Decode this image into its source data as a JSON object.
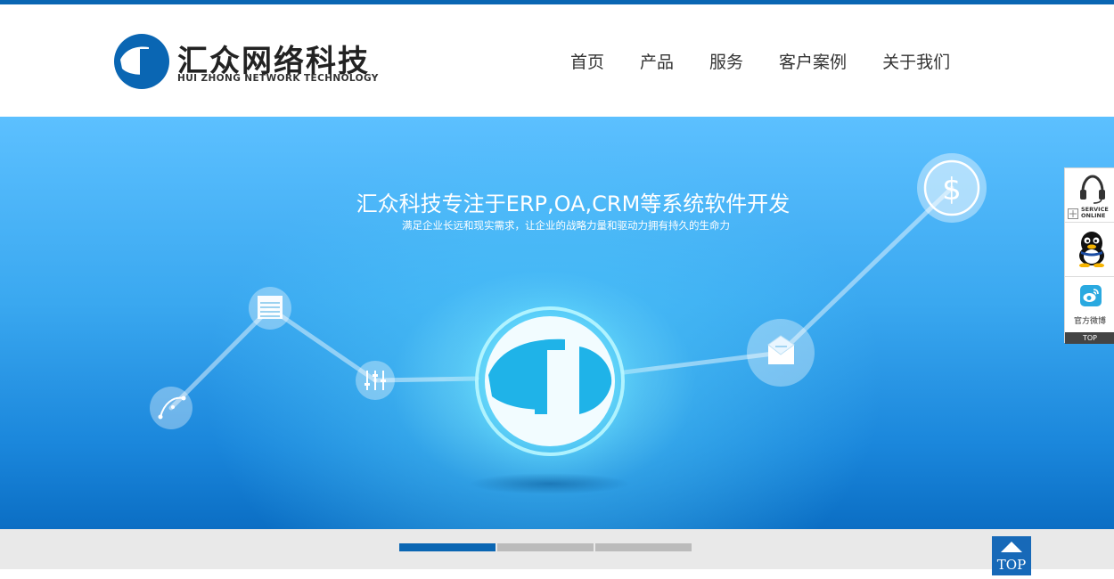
{
  "brand": {
    "name_cn": "汇众网络科技",
    "name_en": "HUI ZHONG NETWORK TECHNOLOGY",
    "color": "#0a66b3"
  },
  "nav": {
    "items": [
      {
        "label": "首页"
      },
      {
        "label": "产品"
      },
      {
        "label": "服务"
      },
      {
        "label": "客户案例"
      },
      {
        "label": "关于我们"
      }
    ]
  },
  "banner": {
    "headline": "汇众科技专注于ERP,OA,CRM等系统软件开发",
    "subline": "满足企业长远和现实需求，让企业的战略力量和驱动力拥有持久的生命力",
    "icons": [
      "vector-pen-icon",
      "notepad-icon",
      "sliders-icon",
      "brand-logo-icon",
      "envelope-icon",
      "dollar-coin-icon"
    ]
  },
  "slider": {
    "count": 3,
    "active_index": 0
  },
  "side_panel": {
    "service_label_line1": "SERVICE",
    "service_label_line2": "ONLINE",
    "weibo_label": "官方微博",
    "top_label": "TOP",
    "icons": [
      "headset-icon",
      "qq-penguin-icon",
      "weibo-icon"
    ]
  },
  "back_to_top": {
    "label": "TOP"
  }
}
